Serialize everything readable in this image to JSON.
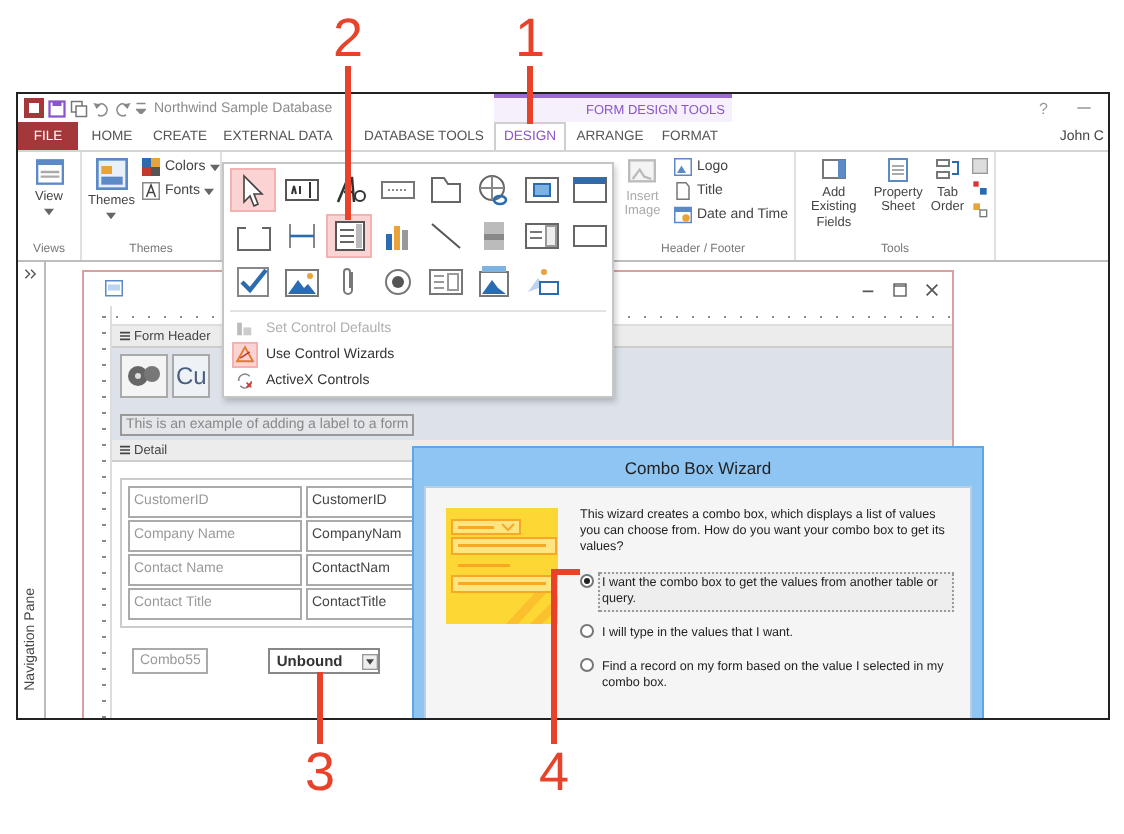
{
  "callouts": [
    {
      "label": "2"
    },
    {
      "label": "1"
    },
    {
      "label": "3"
    },
    {
      "label": "4"
    }
  ],
  "title_bar": {
    "title": "Northwind Sample Database",
    "context_label": "FORM DESIGN TOOLS",
    "help": "?"
  },
  "tabs": [
    {
      "label": "FILE",
      "kind": "file",
      "selected": false
    },
    {
      "label": "HOME",
      "kind": "tab",
      "selected": false
    },
    {
      "label": "CREATE",
      "kind": "tab",
      "selected": false
    },
    {
      "label": "EXTERNAL DATA",
      "kind": "tab",
      "selected": false
    },
    {
      "label": "DATABASE TOOLS",
      "kind": "tab",
      "selected": false
    },
    {
      "label": "DESIGN",
      "kind": "tab",
      "selected": true
    },
    {
      "label": "ARRANGE",
      "kind": "tab",
      "selected": false
    },
    {
      "label": "FORMAT",
      "kind": "tab",
      "selected": false
    }
  ],
  "user": "John C",
  "views_group": {
    "label": "Views",
    "view_button": "View"
  },
  "themes_group": {
    "label": "Themes",
    "themes_button": "Themes",
    "colors_button": "Colors",
    "fonts_button": "Fonts"
  },
  "header_footer_group": {
    "label": "Header / Footer",
    "insert_image": {
      "label": "Insert Image",
      "disabled": true
    },
    "logo": "Logo",
    "title": "Title",
    "date_time": "Date and Time"
  },
  "tools_group": {
    "label": "Tools",
    "buttons": [
      "Add Existing Fields",
      "Property Sheet",
      "Tab Order"
    ]
  },
  "navigation_pane": {
    "label": "Navigation Pane"
  },
  "form_designer": {
    "header_section": "Form Header",
    "title_label": "Cu",
    "label_text": "This is an example of adding a label to a form",
    "detail_section": "Detail",
    "fields": [
      {
        "label": "CustomerID",
        "control": "CustomerID"
      },
      {
        "label": "Company Name",
        "control": "CompanyNam"
      },
      {
        "label": "Contact Name",
        "control": "ContactNam"
      },
      {
        "label": "Contact Title",
        "control": "ContactTitle"
      }
    ],
    "combo_label": "Combo55",
    "combo_value": "Unbound"
  },
  "controls_gallery": {
    "controls": [
      {
        "kind": "pointer",
        "highlighted": true
      },
      {
        "kind": "textbox",
        "highlighted": false
      },
      {
        "kind": "label",
        "highlighted": false
      },
      {
        "kind": "button",
        "highlighted": false
      },
      {
        "kind": "tabcontrol",
        "highlighted": false
      },
      {
        "kind": "hyperlink",
        "highlighted": false
      },
      {
        "kind": "webbrowser",
        "highlighted": false
      },
      {
        "kind": "navigation",
        "highlighted": false
      },
      {
        "kind": "optiongroup",
        "highlighted": false
      },
      {
        "kind": "pagebreak",
        "highlighted": false
      },
      {
        "kind": "combobox",
        "highlighted": true
      },
      {
        "kind": "chart",
        "highlighted": false
      },
      {
        "kind": "line",
        "highlighted": false
      },
      {
        "kind": "togglebutton",
        "highlighted": false
      },
      {
        "kind": "listbox",
        "highlighted": false
      },
      {
        "kind": "rectangle",
        "highlighted": false
      },
      {
        "kind": "checkbox",
        "highlighted": false
      },
      {
        "kind": "image",
        "highlighted": false
      },
      {
        "kind": "attachment",
        "highlighted": false
      },
      {
        "kind": "optionbutton",
        "highlighted": false
      },
      {
        "kind": "subform",
        "highlighted": false
      },
      {
        "kind": "unboundframe",
        "highlighted": false
      },
      {
        "kind": "boundframe",
        "highlighted": false
      }
    ],
    "menu": [
      {
        "label": "Set Control Defaults",
        "kind": "defaults",
        "disabled": true,
        "checked": false
      },
      {
        "label": "Use Control Wizards",
        "kind": "wizards",
        "disabled": false,
        "checked": true
      },
      {
        "label": "ActiveX Controls",
        "kind": "activex",
        "disabled": false,
        "checked": false
      }
    ]
  },
  "wizard": {
    "title": "Combo Box Wizard",
    "intro": "This wizard creates a combo box, which displays a list of values you can choose from.  How do you want your combo box to get its values?",
    "options": [
      {
        "label": "I want the combo box to get the values from another table or query.",
        "selected": true
      },
      {
        "label": "I will type in the values that I want.",
        "selected": false
      },
      {
        "label": "Find a record on my form based on the value I selected in my combo box.",
        "selected": false
      }
    ]
  }
}
